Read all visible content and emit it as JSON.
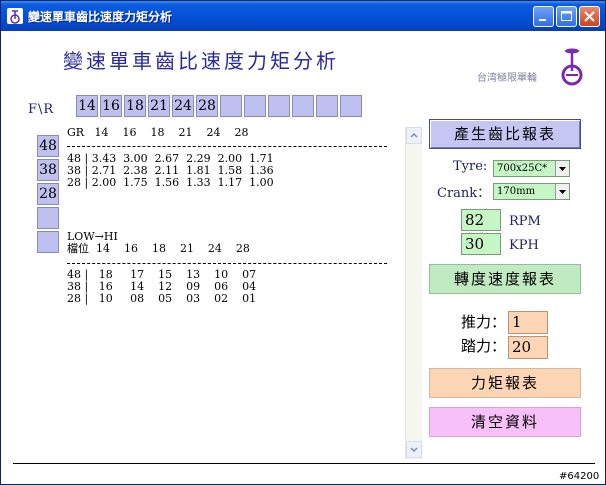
{
  "window": {
    "title": "變速單車齒比速度力矩分析",
    "buttons": [
      "minimize-icon",
      "maximize-icon",
      "close-icon"
    ]
  },
  "header": {
    "app_title": "變速單車齒比速度力矩分析",
    "brand": "台湾極限單輪",
    "logo_icon": "unicycle-icon"
  },
  "gear_grid": {
    "corner_label": "F\\R",
    "rear": [
      "14",
      "16",
      "18",
      "21",
      "24",
      "28",
      "",
      "",
      "",
      "",
      "",
      ""
    ],
    "front": [
      "48",
      "38",
      "28",
      "",
      ""
    ]
  },
  "report": {
    "ratio_header": "GR   14    16    18    21    24    28",
    "ratio_rows": [
      "48 | 3.43  3.00  2.67  2.29  2.00  1.71",
      "38 | 2.71  2.38  2.11  1.81  1.58  1.36",
      "28 | 2.00  1.75  1.56  1.33  1.17  1.00"
    ],
    "low_high": "LOW→HI",
    "rank_header": "檔位  14    16    18    21    24    28",
    "rank_rows": [
      "48 |   18     17    15    13    10    07",
      "38 |   16     14    12    09    06    04",
      "28 |   10     08    05    03    02    01"
    ]
  },
  "controls": {
    "gear_report_button": "產生齒比報表",
    "tyre_label": "Tyre:",
    "tyre_value": "700x25C*",
    "crank_label": "Crank：",
    "crank_value": "170mm",
    "rpm_value": "82",
    "rpm_label": "RPM",
    "kph_value": "30",
    "kph_label": "KPH",
    "speed_report_button": "轉度速度報表",
    "thrust_label": "推力：",
    "thrust_value": "1",
    "pedal_label": "踏力：",
    "pedal_value": "20",
    "torque_report_button": "力矩報表",
    "clear_button": "清空資料"
  },
  "footer_tag": "#64200",
  "colors": {
    "title_blue": "#2a2a9a",
    "cell_purple": "#c0c0f0",
    "field_green": "#c6f6c6",
    "field_peach": "#fcd6b4",
    "button_pink": "#f8c0f8"
  }
}
